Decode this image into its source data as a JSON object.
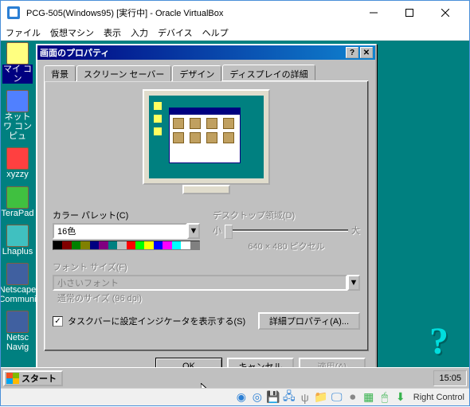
{
  "window": {
    "title": "PCG-505(Windows95) [実行中] - Oracle VirtualBox"
  },
  "menu": {
    "file": "ファイル",
    "machine": "仮想マシン",
    "view": "表示",
    "input": "入力",
    "devices": "デバイス",
    "help": "ヘルプ"
  },
  "desktop_icons": {
    "mycomputer": "マイ コン",
    "network": "ネットワ\nコンピュ",
    "xyzzy": "xyzzy",
    "terapad": "TeraPad",
    "lhaplus": "Lhaplus",
    "netscape_comm": "Netscape Communi",
    "netscape_nav": "Netsc Navig"
  },
  "dialog": {
    "title": "画面のプロパティ",
    "tabs": {
      "background": "背景",
      "screensaver": "スクリーン セーバー",
      "design": "デザイン",
      "display": "ディスプレイの詳細"
    },
    "color_palette": {
      "label": "カラー パレット(C)",
      "value": "16色"
    },
    "desktop_area": {
      "label": "デスクトップ領域(D)",
      "small": "小",
      "large": "大",
      "resolution": "640 × 480 ピクセル"
    },
    "font_size": {
      "label": "フォント サイズ(F)",
      "value": "小さいフォント",
      "sub": "通常のサイズ (96 dpi)"
    },
    "show_indicator": "タスクバーに設定インジケータを表示する(S)",
    "advanced": "詳細プロパティ(A)...",
    "buttons": {
      "ok": "OK",
      "cancel": "キャンセル",
      "apply": "適用(A)"
    }
  },
  "taskbar": {
    "start": "スタート",
    "time": "15:05"
  },
  "statusbar": {
    "host_key": "Right Control"
  },
  "palette_colors": [
    "#000000",
    "#800000",
    "#008000",
    "#808000",
    "#000080",
    "#800080",
    "#008080",
    "#c0c0c0",
    "#ff0000",
    "#00ff00",
    "#ffff00",
    "#0000ff",
    "#ff00ff",
    "#00ffff",
    "#ffffff",
    "#808080"
  ]
}
